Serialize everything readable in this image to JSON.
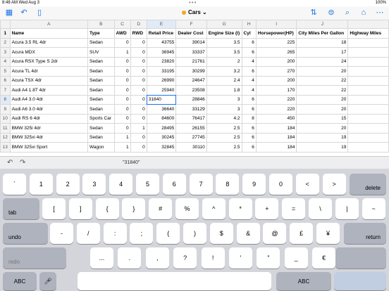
{
  "status": {
    "time": "8:48 AM  Wed Aug 3",
    "battery": "100%"
  },
  "toolbar": {
    "title": "Cars"
  },
  "columns": [
    "",
    "A",
    "B",
    "C",
    "D",
    "E",
    "F",
    "G",
    "H",
    "I",
    "J",
    ""
  ],
  "rows": [
    [
      "1",
      "Name",
      "Type",
      "AWD",
      "RWD",
      "Retail Price",
      "Dealer Cost",
      "Engine Size (l)",
      "Cyl",
      "Horsepower(HP)",
      "City Miles Per Gallon",
      "Highway Miles"
    ],
    [
      "2",
      "Acura 3.5 RL 4dr",
      "Sedan",
      "0",
      "0",
      "43755",
      "39014",
      "3.5",
      "6",
      "225",
      "18",
      ""
    ],
    [
      "3",
      "Acura MDX",
      "SUV",
      "1",
      "0",
      "36945",
      "33337",
      "3.5",
      "6",
      "265",
      "17",
      ""
    ],
    [
      "4",
      "Acura RSX Type S 2dr",
      "Sedan",
      "0",
      "0",
      "23820",
      "21761",
      "2",
      "4",
      "200",
      "24",
      ""
    ],
    [
      "5",
      "Acura TL 4dr",
      "Sedan",
      "0",
      "0",
      "33195",
      "30299",
      "3.2",
      "6",
      "270",
      "20",
      ""
    ],
    [
      "6",
      "Acura TSX 4dr",
      "Sedan",
      "0",
      "0",
      "26990",
      "24647",
      "2.4",
      "4",
      "200",
      "22",
      ""
    ],
    [
      "7",
      "Audi A4 1.8T 4dr",
      "Sedan",
      "0",
      "0",
      "25940",
      "23508",
      "1.8",
      "4",
      "170",
      "22",
      ""
    ],
    [
      "8",
      "Audi A4 3.0 4dr",
      "Sedan",
      "0",
      "0",
      "31840",
      "28846",
      "3",
      "6",
      "220",
      "20",
      ""
    ],
    [
      "9",
      "Audi A6 3.0 4dr",
      "Sedan",
      "0",
      "0",
      "36640",
      "33129",
      "3",
      "6",
      "220",
      "20",
      ""
    ],
    [
      "10",
      "Audi RS 6 4dr",
      "Sports Car",
      "0",
      "0",
      "84600",
      "76417",
      "4.2",
      "8",
      "450",
      "15",
      ""
    ],
    [
      "11",
      "BMW 325i 4dr",
      "Sedan",
      "0",
      "1",
      "28495",
      "26155",
      "2.5",
      "6",
      "184",
      "20",
      ""
    ],
    [
      "12",
      "BMW 325xi 4dr",
      "Sedan",
      "1",
      "0",
      "30245",
      "27745",
      "2.5",
      "6",
      "184",
      "19",
      ""
    ],
    [
      "13",
      "BMW 325xi Sport",
      "Wagon",
      "1",
      "0",
      "32845",
      "30110",
      "2.5",
      "6",
      "184",
      "19",
      ""
    ]
  ],
  "editbar": {
    "preview": "\"31840\""
  },
  "keyboard": {
    "row1": [
      "`",
      "1",
      "2",
      "3",
      "4",
      "5",
      "6",
      "7",
      "8",
      "9",
      "0",
      "<",
      ">"
    ],
    "row1_end": "delete",
    "row2_start": "tab",
    "row2": [
      "[",
      "]",
      "{",
      "}",
      "#",
      "%",
      "^",
      "*",
      "+",
      "=",
      "\\",
      "|",
      "~"
    ],
    "row3_start": "undo",
    "row3": [
      "-",
      "/",
      ":",
      ";",
      "(",
      ")",
      "$",
      "&",
      "@",
      "£",
      "¥"
    ],
    "row3_end": "return",
    "row4_start": "redo",
    "row4": [
      "...",
      ".",
      ",",
      "?",
      "!",
      "'",
      "”",
      "_",
      "€"
    ],
    "row5_start": "ABC",
    "row5_end": "ABC"
  }
}
